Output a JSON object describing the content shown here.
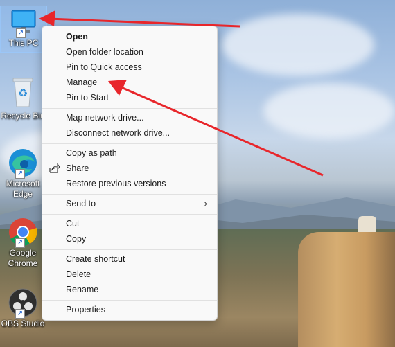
{
  "desktop": {
    "icons": [
      {
        "label": "This PC",
        "icon": "computer-icon"
      },
      {
        "label": "Recycle Bin",
        "icon": "recycle-bin-icon"
      },
      {
        "label": "Microsoft Edge",
        "icon": "edge-icon"
      },
      {
        "label": "Google Chrome",
        "icon": "chrome-icon"
      },
      {
        "label": "OBS Studio",
        "icon": "obs-icon"
      }
    ]
  },
  "context_menu": {
    "items": {
      "open": "Open",
      "open_folder_location": "Open folder location",
      "pin_quick_access": "Pin to Quick access",
      "manage": "Manage",
      "pin_start": "Pin to Start",
      "map_network_drive": "Map network drive...",
      "disconnect_network_drive": "Disconnect network drive...",
      "copy_as_path": "Copy as path",
      "share": "Share",
      "restore_previous_versions": "Restore previous versions",
      "send_to": "Send to",
      "cut": "Cut",
      "copy": "Copy",
      "create_shortcut": "Create shortcut",
      "delete": "Delete",
      "rename": "Rename",
      "properties": "Properties"
    }
  },
  "annotations": {
    "arrow_color": "#e8262b"
  }
}
